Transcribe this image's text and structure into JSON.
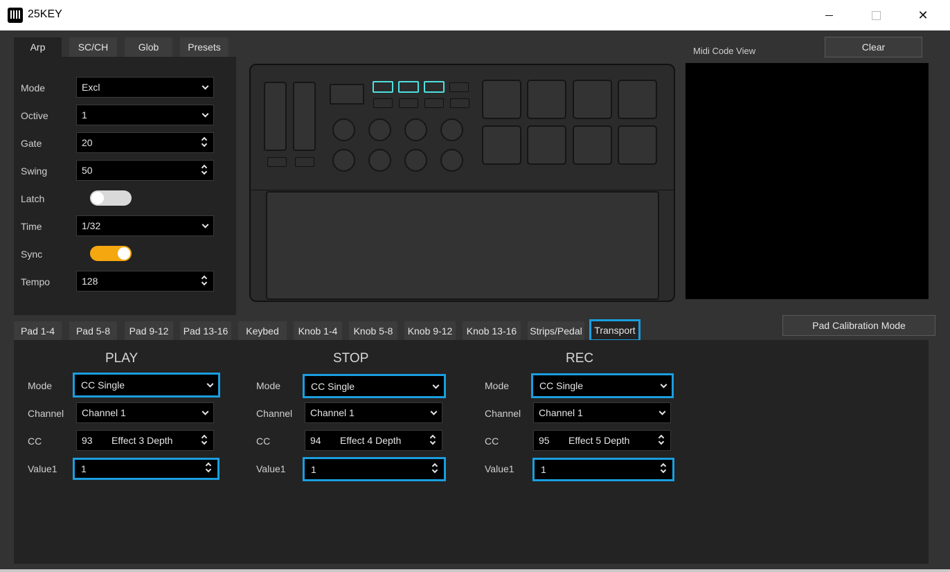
{
  "window": {
    "title": "25KEY",
    "min_glyph": "",
    "max_glyph": "",
    "close_glyph": "✕"
  },
  "top_tabs": [
    "Arp",
    "SC/CH",
    "Glob",
    "Presets"
  ],
  "arp": {
    "mode_label": "Mode",
    "mode_value": "Excl",
    "octave_label": "Octive",
    "octave_value": "1",
    "gate_label": "Gate",
    "gate_value": "20",
    "swing_label": "Swing",
    "swing_value": "50",
    "latch_label": "Latch",
    "latch_on": false,
    "time_label": "Time",
    "time_value": "1/32",
    "sync_label": "Sync",
    "sync_on": true,
    "tempo_label": "Tempo",
    "tempo_value": "128"
  },
  "midi_view": {
    "label": "Midi Code View",
    "clear_label": "Clear"
  },
  "calibration_label": "Pad Calibration Mode",
  "bottom_tabs": [
    "Pad 1-4",
    "Pad 5-8",
    "Pad 9-12",
    "Pad 13-16",
    "Keybed",
    "Knob 1-4",
    "Knob 5-8",
    "Knob 9-12",
    "Knob 13-16",
    "Strips/Pedal",
    "Transport"
  ],
  "transport": {
    "columns": [
      {
        "title": "PLAY",
        "mode_label": "Mode",
        "mode": "CC Single",
        "channel_label": "Channel",
        "channel": "Channel 1",
        "cc_label": "CC",
        "cc_num": "93",
        "cc_name": "Effect 3 Depth",
        "value_label": "Value1",
        "value": "1"
      },
      {
        "title": "STOP",
        "mode_label": "Mode",
        "mode": "CC Single",
        "channel_label": "Channel",
        "channel": "Channel 1",
        "cc_label": "CC",
        "cc_num": "94",
        "cc_name": "Effect 4 Depth",
        "value_label": "Value1",
        "value": "1"
      },
      {
        "title": "REC",
        "mode_label": "Mode",
        "mode": "CC Single",
        "channel_label": "Channel",
        "channel": "Channel 1",
        "cc_label": "CC",
        "cc_num": "95",
        "cc_name": "Effect 5 Depth",
        "value_label": "Value1",
        "value": "1"
      }
    ]
  },
  "colors": {
    "accent_blue": "#1a9ee0",
    "sync_orange": "#f5a70f",
    "pad_highlight_cyan": "#4fe0e0"
  }
}
